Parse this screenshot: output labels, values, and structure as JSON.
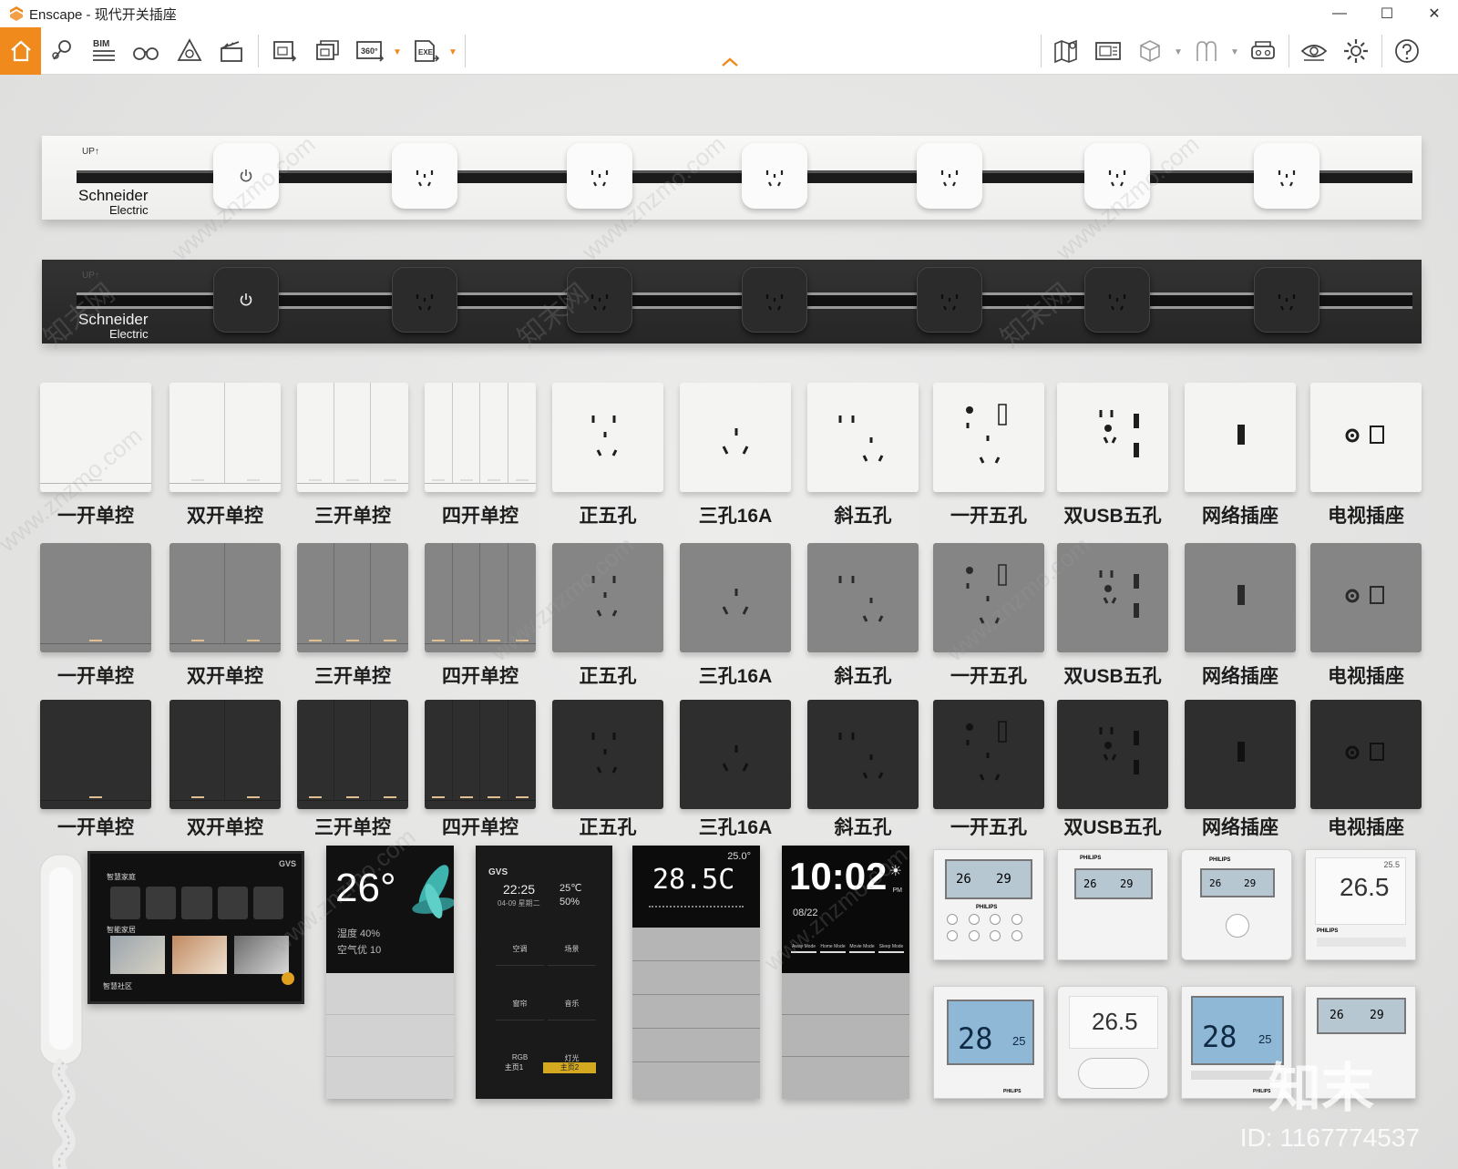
{
  "window": {
    "app_name": "Enscape",
    "title": "Enscape - 现代开关插座",
    "minimize": "—",
    "maximize": "☐",
    "close": "✕"
  },
  "toolbar": {
    "accent": "#f08a1c",
    "left_icons": [
      "home-icon",
      "location-pin-icon",
      "bim-icon",
      "binoculars-icon",
      "atmosphere-icon",
      "video-clapper-icon",
      "render-screenshot-icon",
      "batch-render-icon",
      "panorama-360-icon",
      "exe-export-icon"
    ],
    "bim_label": "BIM",
    "pano_label": "360°",
    "exe_label": "EXE",
    "right_icons": [
      "map-icon",
      "views-icon",
      "cube-icon",
      "asset-library-icon",
      "vr-headset-icon",
      "visibility-eye-icon",
      "settings-gear-icon",
      "help-icon"
    ]
  },
  "tracks": [
    {
      "variant": "white",
      "up_label": "UP↑",
      "brand": "Schneider",
      "brand_sub": "Electric"
    },
    {
      "variant": "black",
      "up_label": "UP↑",
      "brand": "Schneider",
      "brand_sub": "Electric"
    }
  ],
  "panel_labels": [
    "一开单控",
    "双开单控",
    "三开单控",
    "四开单控",
    "正五孔",
    "三孔16A",
    "斜五孔",
    "一开五孔",
    "双USB五孔",
    "网络插座",
    "电视插座"
  ],
  "panel_rows": [
    {
      "variant": "white",
      "color": "#f4f4f3"
    },
    {
      "variant": "grey",
      "color": "#858585"
    },
    {
      "variant": "black",
      "color": "#2e2e2e"
    }
  ],
  "smart_panels": {
    "intercom_brand": "GVS",
    "intercom_menu_1": "智慧家庭",
    "intercom_menu_2": "智能家居",
    "intercom_menu_3": "智慧社区",
    "screen1_temp": "26°",
    "screen1_humidity": "湿度 40%",
    "screen1_air": "空气优 10",
    "screen2_brand": "GVS",
    "screen2_time": "22:25",
    "screen2_date": "04-09 星期二",
    "screen2_temp": "25℃",
    "screen2_hum": "50%",
    "screen2_tiles": [
      "空调",
      "场景",
      "窗帘",
      "音乐",
      "RGB",
      "灯光"
    ],
    "screen2_tabs": [
      "主页1",
      "主页2"
    ],
    "screen3_set": "25.0°",
    "screen3_temp": "28.5C",
    "screen4_time": "10:02",
    "screen4_date": "08/22",
    "screen4_pm": "PM",
    "screen4_modes": [
      "Away Mode",
      "Home Mode",
      "Movie Mode",
      "Sleep Mode"
    ]
  },
  "thermostats": {
    "brand": "PHILIPS",
    "readings_top": [
      "26",
      "29",
      "26",
      "29",
      "26",
      "29",
      "26.5"
    ],
    "readings_bottom": [
      "28",
      "25",
      "26.5",
      "28",
      "25",
      "26",
      "29"
    ],
    "set_small": "25.5"
  },
  "watermark_text": "www.znzmo.com",
  "watermark_cn": "知末网",
  "corner_logo": "知末",
  "image_id": "ID: 1167774537"
}
